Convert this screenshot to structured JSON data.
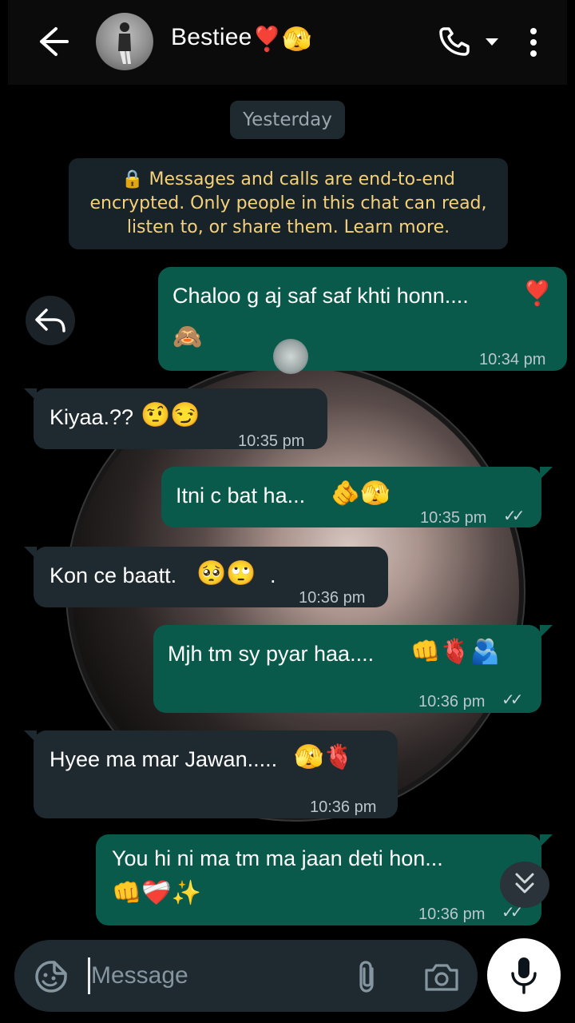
{
  "header": {
    "contact_name": "Bestiee",
    "name_emojis": "❣️🫣"
  },
  "chat": {
    "date_chip": "Yesterday",
    "encryption_notice": "🔒 Messages and calls are end-to-end encrypted. Only people in this chat can read, listen to, or share them. Learn more.",
    "messages": [
      {
        "dir": "out",
        "text": "Chaloo g aj saf saf khti honn....",
        "emoji_inline": "❣️",
        "emoji_line2": "🙈",
        "time": "10:34 pm"
      },
      {
        "dir": "in",
        "text": "Kiyaa.??",
        "emoji": "🤨😏",
        "time": "10:35 pm"
      },
      {
        "dir": "out",
        "text": "Itni c bat ha...",
        "emoji": "🫵🫣",
        "time": "10:35 pm"
      },
      {
        "dir": "in",
        "text": "Kon ce baatt.",
        "emoji": "🥺🙄",
        "suffix": ".",
        "time": "10:36 pm"
      },
      {
        "dir": "out",
        "text": "Mjh tm sy pyar haa....",
        "emoji": "👊🫀🫂",
        "time": "10:36 pm"
      },
      {
        "dir": "in",
        "text": "Hyee ma mar Jawan.....",
        "emoji": "🫣🫀",
        "time": "10:36 pm"
      },
      {
        "dir": "out",
        "text": "You hi ni ma tm ma jaan deti hon...",
        "emoji_line2": "👊❤️‍🩹✨",
        "time": "10:36 pm"
      }
    ],
    "ticks": "✓✓"
  },
  "composer": {
    "placeholder": "Message"
  },
  "colors": {
    "outgoing_bubble": "#0a5a4b",
    "incoming_bubble": "#1f2a30",
    "encryption_text": "#f5d27a"
  }
}
